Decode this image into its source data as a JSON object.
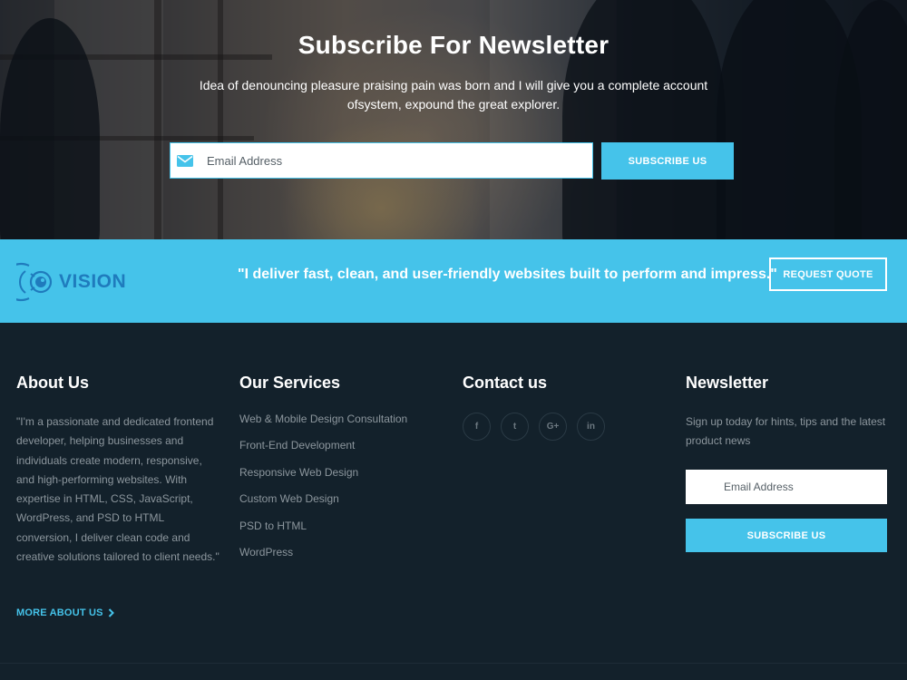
{
  "hero": {
    "title": "Subscribe For Newsletter",
    "description": "Idea of denouncing pleasure praising pain was born and I will give you a complete account ofsystem, expound the great explorer.",
    "email_placeholder": "Email Address",
    "subscribe_label": "SUBSCRIBE US"
  },
  "strip": {
    "logo_text": "VISION",
    "quote": "\"I deliver fast, clean, and user-friendly websites built to perform and impress.\"",
    "request_label": "REQUEST QUOTE"
  },
  "about": {
    "heading": "About Us",
    "text": "\"I'm a passionate and dedicated frontend developer, helping businesses and individuals create modern, responsive, and high-performing websites. With expertise in HTML, CSS, JavaScript, WordPress, and PSD to HTML conversion, I deliver clean code and creative solutions tailored to client needs.\"",
    "more_label": "MORE ABOUT US"
  },
  "services": {
    "heading": "Our Services",
    "items": [
      "Web & Mobile Design Consultation",
      "Front-End Development",
      "Responsive Web Design",
      "Custom Web Design",
      "PSD to HTML",
      "WordPress"
    ]
  },
  "contact": {
    "heading": "Contact us",
    "socials": [
      {
        "icon": "facebook-icon",
        "glyph": "f"
      },
      {
        "icon": "twitter-icon",
        "glyph": "t"
      },
      {
        "icon": "google-plus-icon",
        "glyph": "G+"
      },
      {
        "icon": "linkedin-icon",
        "glyph": "in"
      }
    ]
  },
  "newsletter": {
    "heading": "Newsletter",
    "text": "Sign up today for hints, tips and the latest product news",
    "email_placeholder": "Email Address",
    "subscribe_label": "SUBSCRIBE US"
  },
  "colors": {
    "accent": "#45c3ea",
    "footer_bg": "#13212b",
    "logo_blue": "#1f7bbd"
  }
}
